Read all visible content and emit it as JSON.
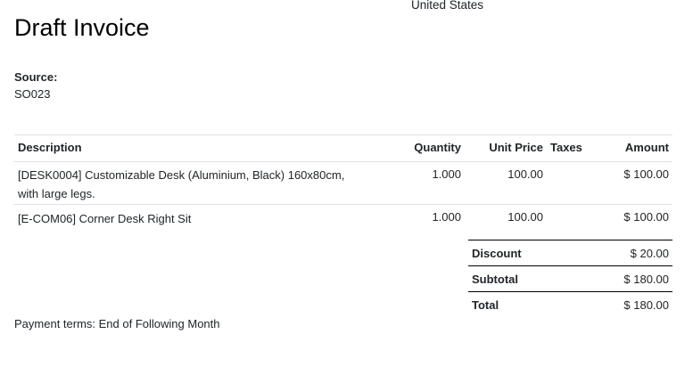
{
  "address": {
    "country": "United States"
  },
  "document": {
    "title": "Draft Invoice"
  },
  "source": {
    "label": "Source:",
    "value": "SO023"
  },
  "table": {
    "headers": {
      "description": "Description",
      "quantity": "Quantity",
      "unit_price": "Unit Price",
      "taxes": "Taxes",
      "amount": "Amount"
    },
    "rows": [
      {
        "description": "[DESK0004] Customizable Desk (Aluminium, Black) 160x80cm, with large legs.",
        "quantity": "1.000",
        "unit_price": "100.00",
        "taxes": "",
        "amount": "$ 100.00"
      },
      {
        "description": "[E-COM06] Corner Desk Right Sit",
        "quantity": "1.000",
        "unit_price": "100.00",
        "taxes": "",
        "amount": "$ 100.00"
      }
    ]
  },
  "totals": {
    "discount": {
      "label": "Discount",
      "value": "$ 20.00"
    },
    "subtotal": {
      "label": "Subtotal",
      "value": "$ 180.00"
    },
    "total": {
      "label": "Total",
      "value": "$ 180.00"
    }
  },
  "payment_terms": "Payment terms: End of Following Month"
}
